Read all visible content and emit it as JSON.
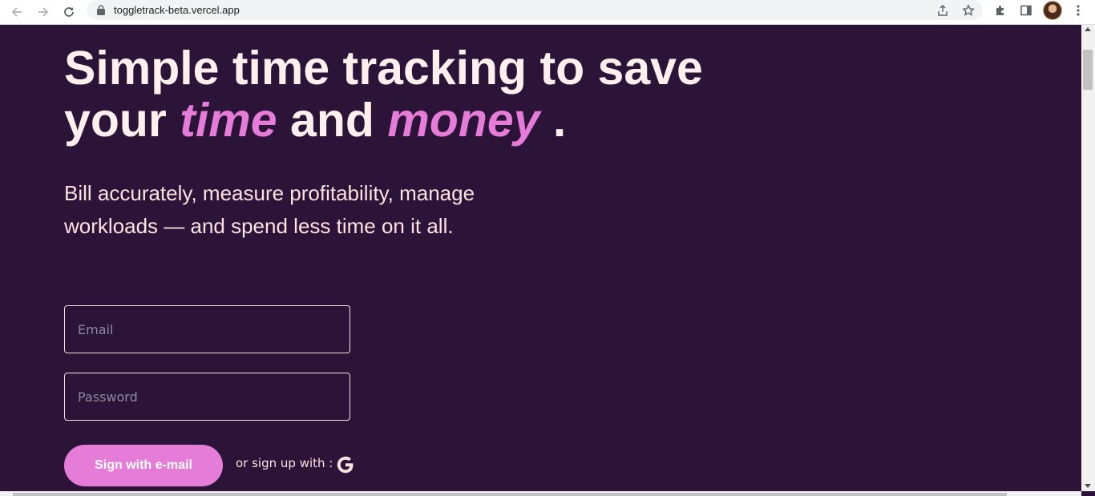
{
  "browser": {
    "url": "toggletrack-beta.vercel.app",
    "icons": [
      "back-arrow-icon",
      "forward-arrow-icon",
      "reload-icon",
      "lock-icon",
      "share-icon",
      "bookmark-star-icon",
      "extensions-puzzle-icon",
      "side-panel-icon",
      "profile-avatar",
      "kebab-menu-icon"
    ]
  },
  "hero": {
    "title_line1": "Simple time tracking to save",
    "title_your": "your",
    "title_time": "time",
    "title_and": "and",
    "title_money": "money",
    "title_period": ".",
    "subtitle": "Bill accurately, measure profitability, manage workloads — and spend less time on it all."
  },
  "form": {
    "email_placeholder": "Email",
    "password_placeholder": "Password",
    "submit_label": "Sign with e-mail",
    "alt_signup_text": "or sign up with :"
  },
  "colors": {
    "background": "#2c1338",
    "accent": "#e57cd8",
    "text": "#fde2e2"
  }
}
